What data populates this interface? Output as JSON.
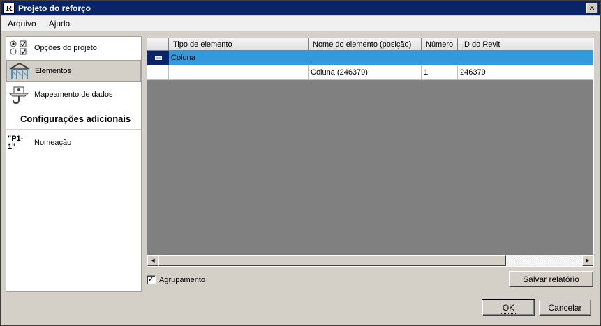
{
  "window": {
    "title": "Projeto do reforço",
    "icon_letter": "R",
    "close_glyph": "✕"
  },
  "menu": [
    "Arquivo",
    "Ajuda"
  ],
  "nav": {
    "items": [
      {
        "label": "Opções do projeto",
        "icon": "radio-checkbox-options-icon"
      },
      {
        "label": "Elementos",
        "icon": "structural-frame-icon",
        "selected": true
      },
      {
        "label": "Mapeamento de dados",
        "icon": "data-mapping-icon"
      }
    ],
    "section_title": "Configurações adicionais",
    "extra_items": [
      {
        "label": "Nomeação",
        "icon_text": "\"P1-1\""
      }
    ]
  },
  "grid": {
    "columns": [
      "Tipo de elemento",
      "Nome do elemento (posição)",
      "Número",
      "ID do Revit"
    ],
    "group_row": {
      "label": "Coluna"
    },
    "rows": [
      {
        "tipo": "",
        "nome": "Coluna (246379)",
        "numero": "1",
        "id": "246379"
      }
    ],
    "scroll": {
      "left_glyph": "◀",
      "right_glyph": "▶"
    }
  },
  "options": {
    "grouping_label": "Agrupamento",
    "grouping_checked": true,
    "check_glyph": "✓"
  },
  "buttons": {
    "save_report": "Salvar relatório",
    "ok": "OK",
    "cancel": "Cancelar"
  },
  "colors": {
    "title_bar": "#0a246a",
    "group_row": "#3399dd",
    "grid_background": "#808080"
  }
}
